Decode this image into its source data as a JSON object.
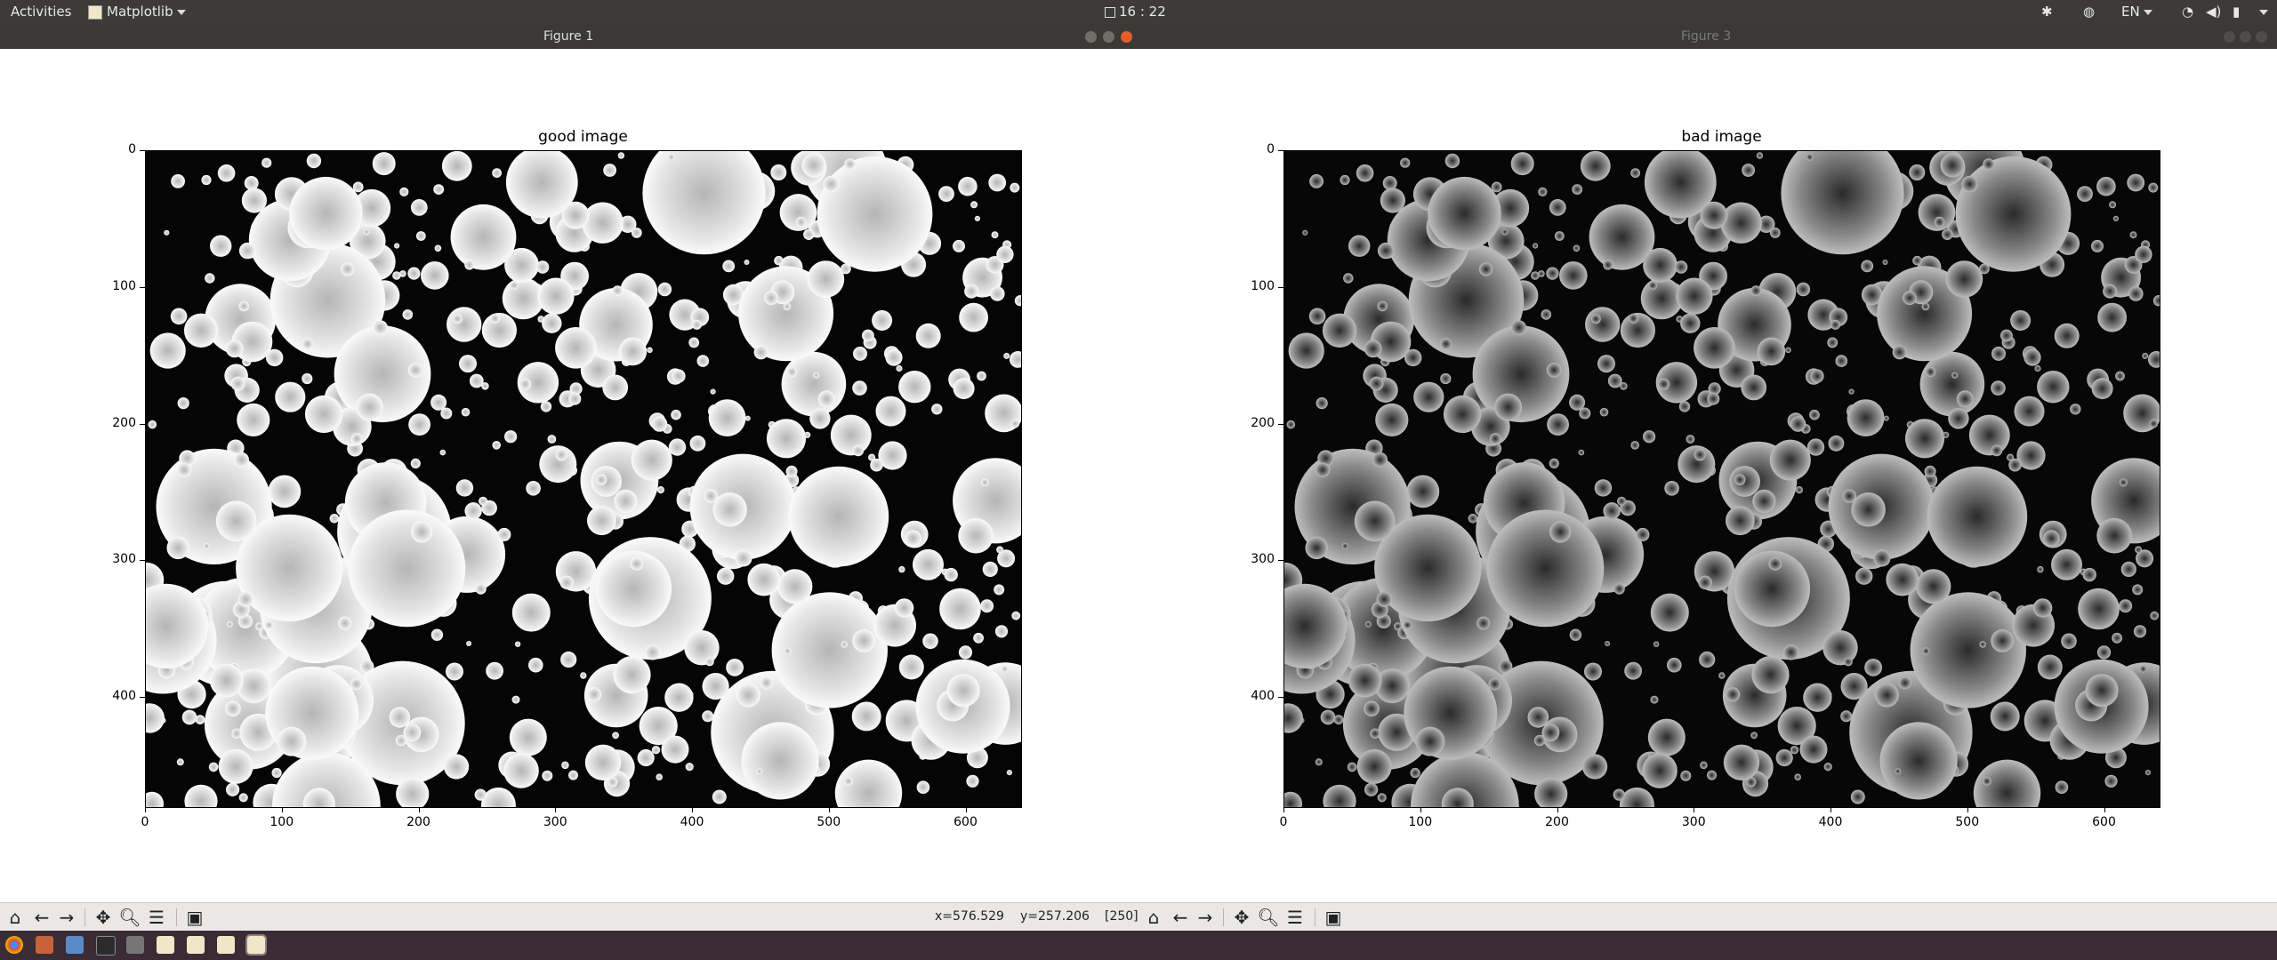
{
  "topbar": {
    "activities": "Activities",
    "app_menu": "Matplotlib",
    "clock": "16 : 22",
    "language": "EN",
    "status_icons": [
      "settings-icon",
      "network-icon",
      "wifi-icon",
      "volume-icon",
      "battery-icon",
      "power-icon"
    ]
  },
  "windows": [
    {
      "title": "Figure 1",
      "active": true
    },
    {
      "title": "Figure 3",
      "active": false
    }
  ],
  "figures": [
    {
      "axes_title": "good image",
      "y_ticks": [
        "0",
        "100",
        "200",
        "300",
        "400"
      ],
      "x_ticks": [
        "0",
        "100",
        "200",
        "300",
        "400",
        "500",
        "600"
      ],
      "image_palette": {
        "background": "#050505",
        "particle": "#e6e6e6",
        "particle_shade": "#b5b5b5"
      }
    },
    {
      "axes_title": "bad image",
      "y_ticks": [
        "0",
        "100",
        "200",
        "300",
        "400"
      ],
      "x_ticks": [
        "0",
        "100",
        "200",
        "300",
        "400",
        "500",
        "600"
      ],
      "image_palette": {
        "background": "#070707",
        "particle": "#bdbdbd",
        "particle_shade": "#2a2a2a"
      }
    }
  ],
  "toolbar": {
    "buttons": [
      "home-icon",
      "back-icon",
      "forward-icon",
      "pan-icon",
      "zoom-icon",
      "configure-subplots-icon",
      "save-icon"
    ],
    "x_readout": "x=576.529",
    "y_readout": "y=257.206",
    "pixel_value": "[250]"
  },
  "dock": {
    "apps": [
      "chrome-icon",
      "files-icon",
      "image-viewer-icon",
      "terminal-icon",
      "screenshot-icon",
      "matplotlib-icon",
      "matplotlib-icon",
      "matplotlib-icon",
      "matplotlib-icon"
    ]
  }
}
